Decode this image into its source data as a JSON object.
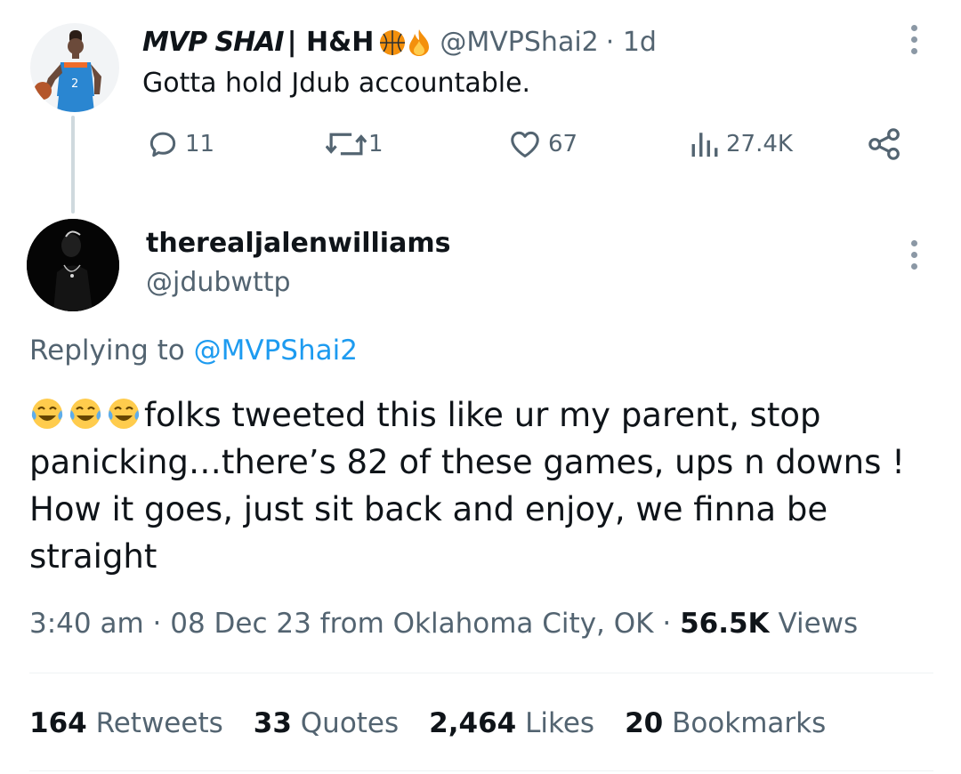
{
  "parent_tweet": {
    "display_name": "MVP SHAI",
    "display_name_suffix": "| H&H",
    "name_emojis": [
      "basketball-emoji",
      "fire-emoji"
    ],
    "handle": "@MVPShai2",
    "time_ago": "· 1d",
    "text": "Gotta hold Jdub accountable.",
    "actions": {
      "replies": "11",
      "retweets": "1",
      "likes": "67",
      "views": "27.4K"
    }
  },
  "reply_tweet": {
    "display_name": "therealjalenwilliams",
    "handle": "@jdubwttp",
    "replying_to_label": "Replying to",
    "replying_to_handle": "@MVPShai2",
    "leading_emojis": [
      "laughing-tears-emoji",
      "laughing-tears-emoji",
      "laughing-tears-emoji"
    ],
    "text": "folks tweeted this like ur my parent, stop panicking…there’s 82 of these games, ups n downs ! How it goes, just sit back and enjoy, we finna be straight",
    "meta": {
      "time_date_location": "3:40 am · 08 Dec 23 from Oklahoma City, OK ·",
      "views_count": "56.5K",
      "views_label": "Views"
    },
    "stats": {
      "retweets_count": "164",
      "retweets_label": "Retweets",
      "quotes_count": "33",
      "quotes_label": "Quotes",
      "likes_count": "2,464",
      "likes_label": "Likes",
      "bookmarks_count": "20",
      "bookmarks_label": "Bookmarks"
    }
  },
  "colors": {
    "text_primary": "#0f1419",
    "text_secondary": "#536471",
    "link": "#1d9bf0",
    "divider": "#eff3f4"
  }
}
